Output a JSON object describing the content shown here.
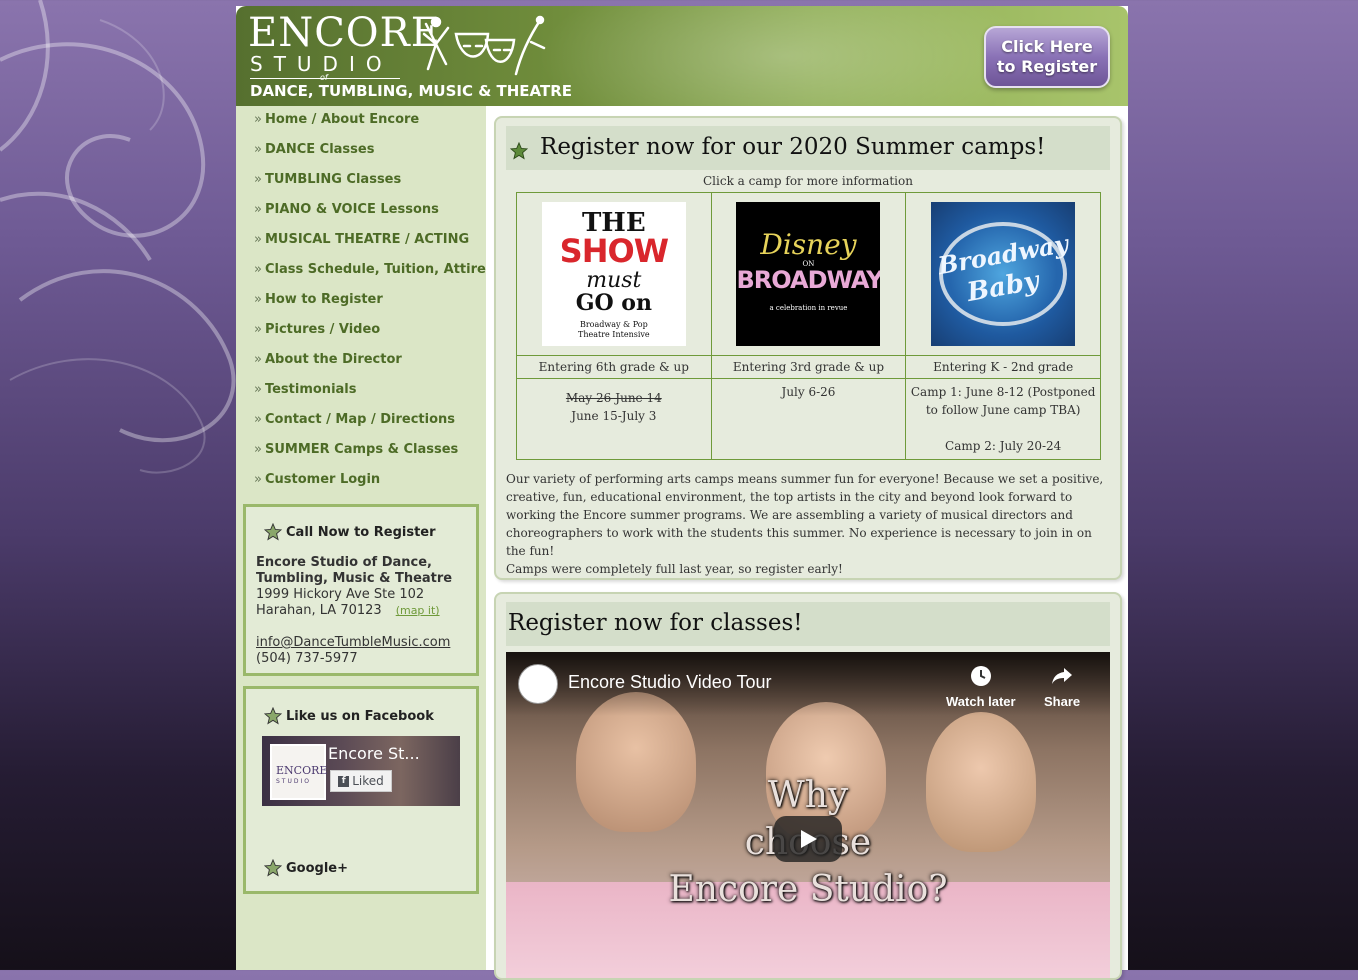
{
  "header": {
    "logo_encore": "ENCORE",
    "logo_studio": "STUDIO",
    "logo_of": "of",
    "logo_sub": "DANCE, TUMBLING, MUSIC & THEATRE",
    "register_line1": "Click Here",
    "register_line2": "to Register"
  },
  "nav": {
    "chevron": "»",
    "items": [
      "Home / About Encore",
      "DANCE Classes",
      "TUMBLING Classes",
      "PIANO & VOICE Lessons",
      "MUSICAL THEATRE / ACTING",
      "Class Schedule, Tuition, Attire",
      "How to Register",
      "Pictures / Video",
      "About the Director",
      "Testimonials",
      "Contact / Map / Directions",
      "SUMMER Camps & Classes",
      "Customer Login"
    ]
  },
  "contact": {
    "title": "Call Now to Register",
    "name_line1": "Encore Studio of Dance,",
    "name_line2": "Tumbling, Music & Theatre",
    "address1": "1999 Hickory Ave Ste 102",
    "address2": "Harahan, LA 70123",
    "map_link": "(map it)",
    "email": "info@DanceTumbleMusic.com",
    "phone": "(504) 737-5977"
  },
  "facebook": {
    "title": "Like us on Facebook",
    "page_name": "Encore St...",
    "liked_label": "Liked",
    "thumb_text1": "ENCORE",
    "thumb_text2": "STUDIO",
    "googleplus_title": "Google+"
  },
  "camps": {
    "heading": "Register now for our 2020 Summer camps!",
    "click_note": "Click a camp for more information",
    "items": [
      {
        "grade": "Entering 6th grade & up",
        "date_struck": "May 26-June 14",
        "date": "June 15-July 3",
        "img_line1": "THE",
        "img_line2": "SHOW",
        "img_line3": "must",
        "img_line4": "GO on",
        "img_line5": "Broadway & Pop",
        "img_line6": "Theatre Intensive"
      },
      {
        "grade": "Entering 3rd grade & up",
        "date": "July 6-26",
        "img_line1": "Disney",
        "img_line2": "ON",
        "img_line3": "BROADWAY",
        "img_line4": "a celebration in revue"
      },
      {
        "grade": "Entering K - 2nd grade",
        "date1": "Camp 1: June 8-12 (Postponed to follow June camp TBA)",
        "date2": "Camp 2: July 20-24",
        "img_line1": "Broadway",
        "img_line2": "Baby"
      }
    ],
    "description": "Our variety of performing arts camps means summer fun for everyone! Because we set a positive, creative, fun, educational environment, the top artists in the city and beyond look forward to working the Encore summer programs. We are assembling a variety of musical directors and choreographers to work with the students this summer. No experience is necessary to join in on the fun!",
    "description2": "Camps were completely full last year, so register early!"
  },
  "classes": {
    "heading": "Register now for classes!",
    "video_title": "Encore Studio Video Tour",
    "watch_later": "Watch later",
    "share": "Share",
    "overlay_line1": "Why",
    "overlay_line2": "choose",
    "overlay_line3": "Encore Studio?"
  },
  "colors": {
    "accent_green": "#6f9a3a",
    "nav_text": "#4d6b26",
    "sidebar_bg": "#dbe6c6",
    "register_purple": "#8a72b6"
  }
}
